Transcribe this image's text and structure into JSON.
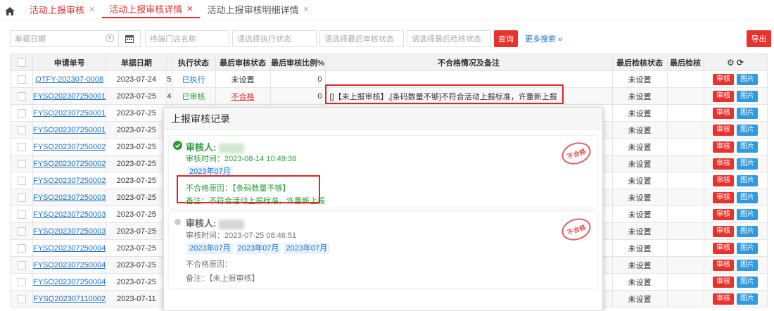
{
  "tabs": [
    {
      "label": "活动上报审核"
    },
    {
      "label": "活动上报审核详情"
    },
    {
      "label": "活动上报审核明细详情"
    }
  ],
  "filters": {
    "date_placeholder": "单据日期",
    "store_placeholder": "终端门店名称",
    "exec_placeholder": "请选择执行状态",
    "audit_placeholder": "请选择最后审核状态",
    "check_placeholder": "请选择最后检核状态",
    "query_label": "查询",
    "more_label": "更多搜索",
    "export_label": "导出"
  },
  "columns": {
    "order_no": "申请单号",
    "date": "单据日期",
    "exec": "执行状态",
    "last_audit": "最后审核状态",
    "ratio": "最后审核比例%",
    "notes": "不合格情况及备注",
    "last_check": "最后检核状态",
    "last_check2": "最后检核"
  },
  "actions": {
    "audit": "审核",
    "image": "图片"
  },
  "rows": [
    {
      "no": "QTFY-202307-0008",
      "date": "2023-07-24",
      "n": "5",
      "exec": "已执行",
      "audit": "未设置",
      "ratio": "0",
      "notes": "",
      "check": "未设置"
    },
    {
      "no": "FYSQ202307250001",
      "date": "2023-07-25",
      "n": "4",
      "exec": "已审核",
      "audit": "不合格",
      "ratio": "0",
      "notes": "[]【未上报审核】,[条码数量不够]不符合活动上报标准，许重新上报",
      "check": "未设置"
    },
    {
      "no": "FYSQ202307250001",
      "date": "2023-07-25",
      "n": "",
      "exec": "",
      "audit": "",
      "ratio": "",
      "notes": "",
      "check": "未设置"
    },
    {
      "no": "FYSQ202307250001",
      "date": "2023-07-25",
      "n": "",
      "exec": "",
      "audit": "",
      "ratio": "",
      "notes": "",
      "check": "未设置"
    },
    {
      "no": "FYSQ202307250002",
      "date": "2023-07-25",
      "n": "",
      "exec": "",
      "audit": "",
      "ratio": "",
      "notes": "",
      "check": "未设置"
    },
    {
      "no": "FYSQ202307250002",
      "date": "2023-07-25",
      "n": "",
      "exec": "",
      "audit": "",
      "ratio": "",
      "notes": "",
      "check": "未设置"
    },
    {
      "no": "FYSQ202307250002",
      "date": "2023-07-25",
      "n": "",
      "exec": "",
      "audit": "",
      "ratio": "",
      "notes": "",
      "check": "未设置"
    },
    {
      "no": "FYSQ202307250003",
      "date": "2023-07-25",
      "n": "",
      "exec": "",
      "audit": "",
      "ratio": "",
      "notes": "",
      "check": "未设置"
    },
    {
      "no": "FYSQ202307250003",
      "date": "2023-07-25",
      "n": "",
      "exec": "",
      "audit": "",
      "ratio": "",
      "notes": "",
      "check": "未设置"
    },
    {
      "no": "FYSQ202307250003",
      "date": "2023-07-25",
      "n": "",
      "exec": "",
      "audit": "",
      "ratio": "",
      "notes": "",
      "check": "未设置"
    },
    {
      "no": "FYSQ202307250004",
      "date": "2023-07-25",
      "n": "",
      "exec": "",
      "audit": "",
      "ratio": "",
      "notes": "",
      "check": "未设置"
    },
    {
      "no": "FYSQ202307250004",
      "date": "2023-07-25",
      "n": "",
      "exec": "",
      "audit": "",
      "ratio": "",
      "notes": "",
      "check": "未设置"
    },
    {
      "no": "FYSQ202307250004",
      "date": "2023-07-25",
      "n": "",
      "exec": "",
      "audit": "",
      "ratio": "",
      "notes": "",
      "check": "未设置"
    },
    {
      "no": "FYSQ202307110002",
      "date": "2023-07-11",
      "n": "",
      "exec": "",
      "audit": "",
      "ratio": "",
      "notes": "",
      "check": "未设置"
    }
  ],
  "popup": {
    "title": "上报审核记录",
    "records": [
      {
        "reviewer_label": "审核人:",
        "time": "审核时间：2023-08-14 10:49:38",
        "months": [
          "2023年07月"
        ],
        "reason": "不合格原因：【条码数量不够】",
        "remark": "备注：不符合活动上报标准，许重新上报",
        "stamp": "不合格"
      },
      {
        "reviewer_label": "审核人:",
        "time": "审核时间：2023-07-25 08:46:51",
        "months": [
          "2023年07月",
          "2023年07月",
          "2023年07月"
        ],
        "reason": "不合格原因：",
        "remark": "备注：【未上报审核】",
        "stamp": "不合格"
      }
    ]
  },
  "colors": {
    "accent_red": "#e8322b",
    "link_blue": "#1a73c8",
    "ok_green": "#2a9d3a"
  }
}
